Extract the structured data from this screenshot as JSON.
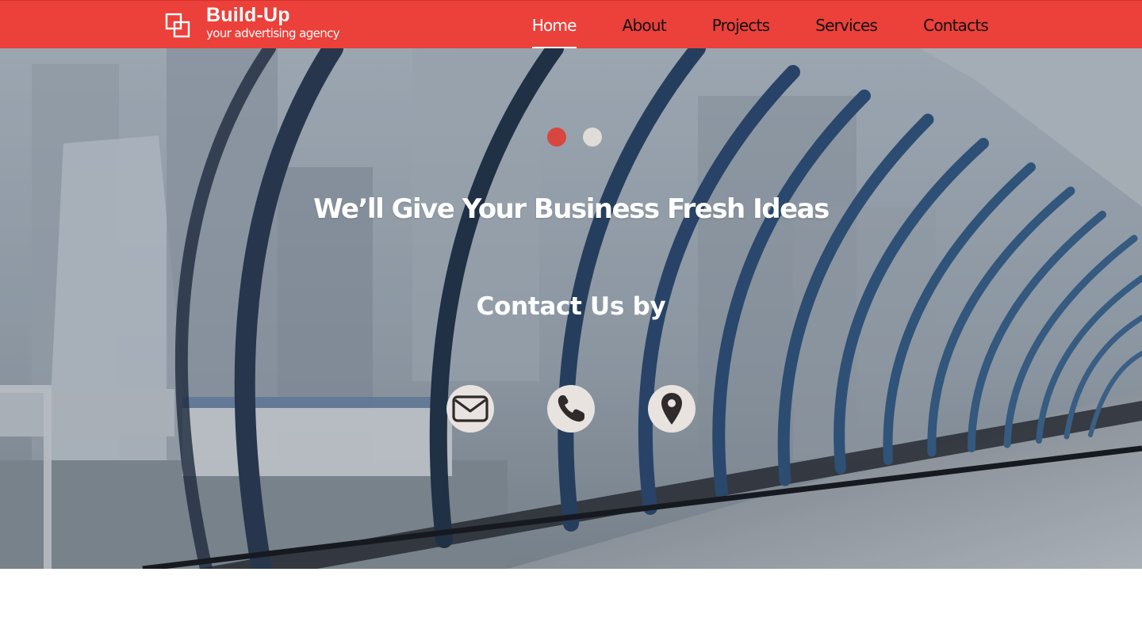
{
  "brand": {
    "title": "Build-Up",
    "subtitle": "your advertising agency",
    "logo_icon": "overlapping-squares-icon"
  },
  "nav": {
    "items": [
      {
        "label": "Home",
        "active": true
      },
      {
        "label": "About",
        "active": false
      },
      {
        "label": "Projects",
        "active": false
      },
      {
        "label": "Services",
        "active": false
      },
      {
        "label": "Contacts",
        "active": false
      }
    ]
  },
  "hero": {
    "slider_dots": [
      {
        "active": true
      },
      {
        "active": false
      }
    ],
    "headline": "We’ll Give Your Business Fresh Ideas",
    "contact_title": "Contact Us by",
    "contact_icons": [
      "envelope-icon",
      "phone-icon",
      "map-pin-icon"
    ]
  },
  "colors": {
    "header_bg": "#ec403a",
    "accent_dot": "#d9463f",
    "icon_circle": "#e8e3df",
    "icon_glyph": "#2f2b2b"
  }
}
